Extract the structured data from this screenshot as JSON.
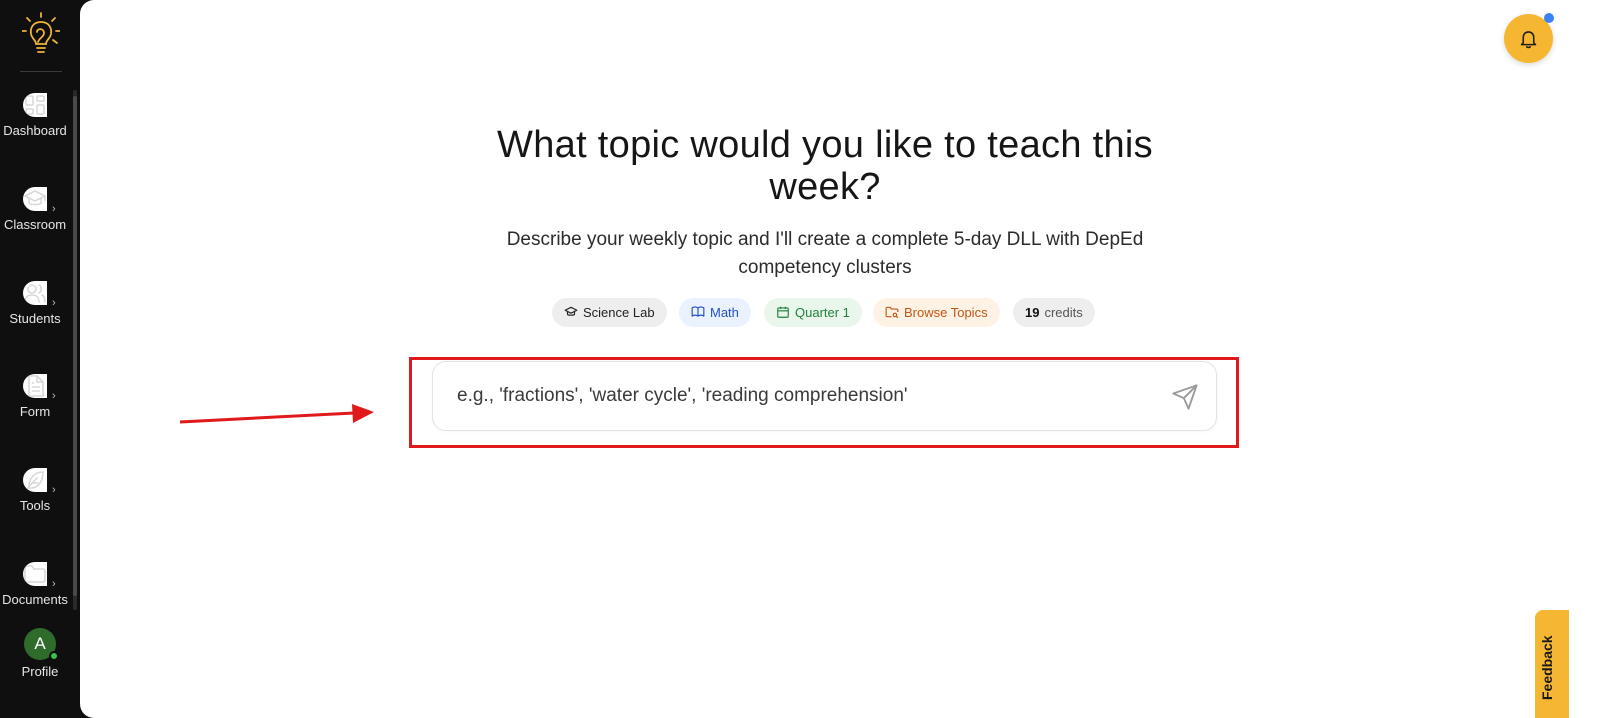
{
  "sidebar": {
    "items": [
      {
        "label": "Dashboard"
      },
      {
        "label": "Classroom"
      },
      {
        "label": "Students"
      },
      {
        "label": "Form"
      },
      {
        "label": "Tools"
      },
      {
        "label": "Documents"
      }
    ],
    "profile": {
      "initial": "A",
      "label": "Profile"
    }
  },
  "main": {
    "headline": "What topic would you like to teach this week?",
    "subline": "Describe your weekly topic and I'll create a complete 5-day DLL with DepEd competency clusters",
    "chips": {
      "science_lab": "Science Lab",
      "math": "Math",
      "quarter": "Quarter 1",
      "browse": "Browse Topics",
      "credits_count": "19",
      "credits_label": "credits"
    },
    "input": {
      "placeholder": "e.g., 'fractions', 'water cycle', 'reading comprehension'",
      "value": ""
    }
  },
  "feedback_label": "Feedback",
  "colors": {
    "accent": "#f5b731",
    "highlight": "#e0191b",
    "notification_dot": "#3b82f6",
    "online": "#38c24a"
  },
  "icons": [
    "logo-icon",
    "dashboard-icon",
    "graduation-cap-icon",
    "users-icon",
    "file-text-icon",
    "feather-icon",
    "folder-icon",
    "bell-icon",
    "send-icon",
    "book-icon",
    "calendar-icon",
    "folder-search-icon"
  ]
}
